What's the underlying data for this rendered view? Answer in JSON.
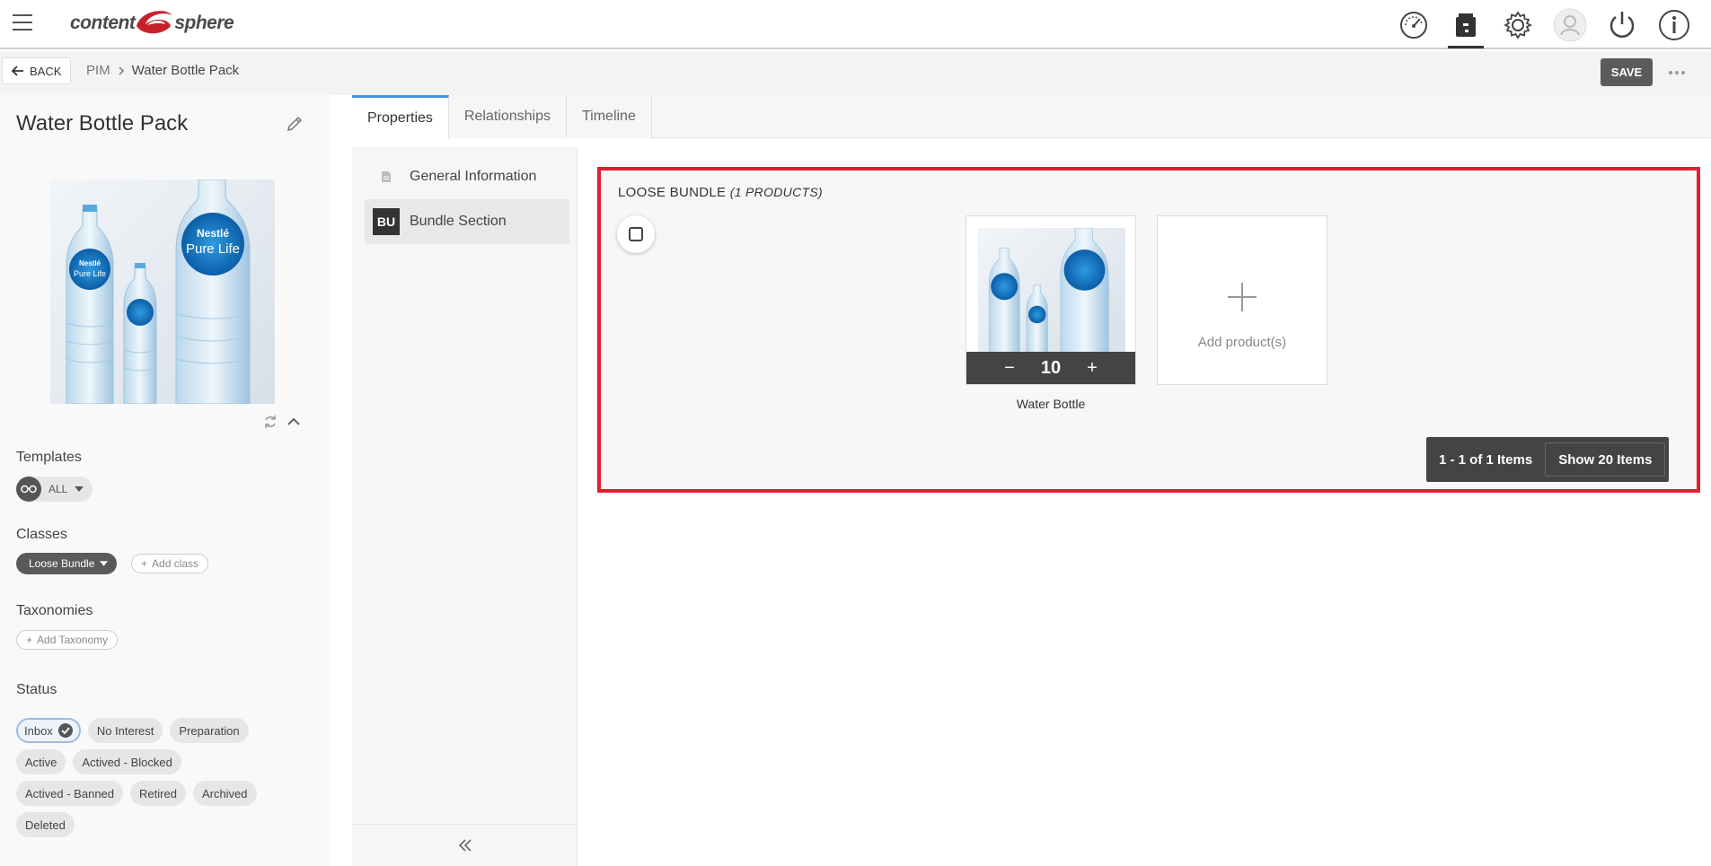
{
  "app": {
    "logo_left": "content",
    "logo_right": "sphere"
  },
  "topbar": {
    "icons": [
      "dashboard-icon",
      "product-icon",
      "settings-icon",
      "user-icon",
      "power-icon",
      "info-icon"
    ]
  },
  "subbar": {
    "back_label": "BACK",
    "breadcrumb": [
      "PIM",
      "Water Bottle Pack"
    ],
    "save_label": "SAVE"
  },
  "left": {
    "title": "Water Bottle Pack",
    "templates_label": "Templates",
    "template_value": "ALL",
    "classes_label": "Classes",
    "class_value": "Loose Bundle",
    "add_class_label": "Add class",
    "taxonomies_label": "Taxonomies",
    "add_taxonomy_label": "Add Taxonomy",
    "status_label": "Status",
    "statuses": [
      "Inbox",
      "No Interest",
      "Preparation",
      "Active",
      "Actived - Blocked",
      "Actived - Banned",
      "Retired",
      "Archived",
      "Deleted"
    ],
    "selected_status": "Inbox"
  },
  "tabs": [
    "Properties",
    "Relationships",
    "Timeline"
  ],
  "sections": {
    "general": "General Information",
    "bundle_badge": "BU",
    "bundle": "Bundle Section"
  },
  "bundle": {
    "title": "LOOSE BUNDLE",
    "count_text": "(1 PRODUCTS)",
    "product_name": "Water Bottle",
    "quantity": "10",
    "qty_minus": "−",
    "qty_plus": "+",
    "add_label": "Add product(s)",
    "pager_text": "1 - 1 of 1 Items",
    "show_label": "Show 20 Items"
  },
  "bottle_label": {
    "brand": "Nestlé",
    "line": "Pure Life"
  },
  "colors": {
    "highlight_border": "#e0202f",
    "tab_accent": "#4a8fdc",
    "logo_red": "#c8202b"
  }
}
